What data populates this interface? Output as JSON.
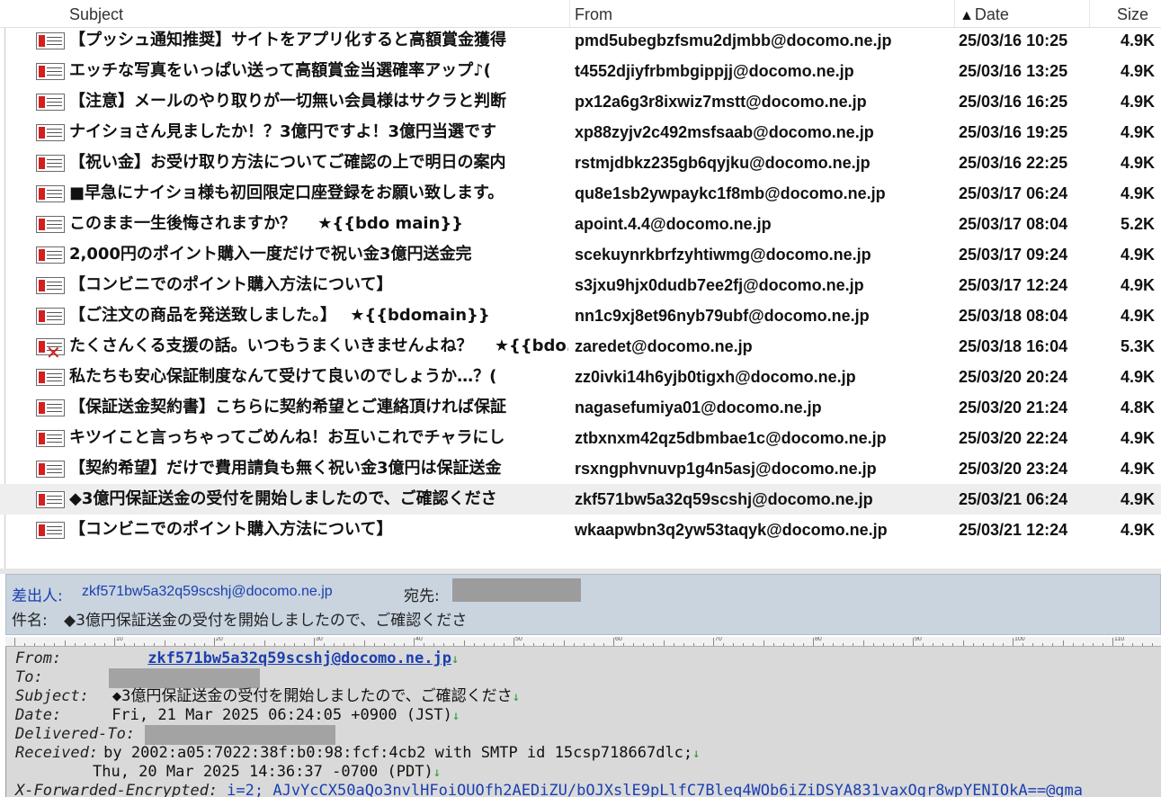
{
  "list": {
    "columns": {
      "subject": "Subject",
      "from": "From",
      "date": "Date",
      "size": "Size",
      "sort_arrow": "▲"
    },
    "rows": [
      {
        "subject": "【プッシュ通知推奨】サイトをアプリ化すると高額賞金獲得",
        "from": "pmd5ubegbzfsmu2djmbb@docomo.ne.jp",
        "date": "25/03/16 10:25",
        "size": "4.9K",
        "icon": "mail-icon"
      },
      {
        "subject": "エッチな写真をいっぱい送って高額賞金当選確率アップ♪(",
        "from": "t4552djiyfrbmbgippjj@docomo.ne.jp",
        "date": "25/03/16 13:25",
        "size": "4.9K",
        "icon": "mail-icon"
      },
      {
        "subject": "【注意】メールのやり取りが一切無い会員様はサクラと判断",
        "from": "px12a6g3r8ixwiz7mstt@docomo.ne.jp",
        "date": "25/03/16 16:25",
        "size": "4.9K",
        "icon": "mail-icon"
      },
      {
        "subject": "ナイショさん見ましたか！？3億円ですよ！3億円当選です",
        "from": "xp88zyjv2c492msfsaab@docomo.ne.jp",
        "date": "25/03/16 19:25",
        "size": "4.9K",
        "icon": "mail-icon"
      },
      {
        "subject": "【祝い金】お受け取り方法についてご確認の上で明日の案内",
        "from": "rstmjdbkz235gb6qyjku@docomo.ne.jp",
        "date": "25/03/16 22:25",
        "size": "4.9K",
        "icon": "mail-icon"
      },
      {
        "subject": "■早急にナイショ様も初回限定口座登録をお願い致します。",
        "from": "qu8e1sb2ywpaykc1f8mb@docomo.ne.jp",
        "date": "25/03/17 06:24",
        "size": "4.9K",
        "icon": "mail-icon"
      },
      {
        "subject": "このまま一生後悔されますか？　 ★{{bdo main}}",
        "from": "apoint.4.4@docomo.ne.jp",
        "date": "25/03/17 08:04",
        "size": "5.2K",
        "icon": "mail-icon"
      },
      {
        "subject": "2,000円のポイント購入一度だけで祝い金3億円送金完",
        "from": "scekuynrkbrfzyhtiwmg@docomo.ne.jp",
        "date": "25/03/17 09:24",
        "size": "4.9K",
        "icon": "mail-icon"
      },
      {
        "subject": "【コンビニでのポイント購入方法について】",
        "from": "s3jxu9hjx0dudb7ee2fj@docomo.ne.jp",
        "date": "25/03/17 12:24",
        "size": "4.9K",
        "icon": "mail-icon"
      },
      {
        "subject": "【ご注文の商品を発送致しました。】　 ★{{bdomain}}",
        "from": "nn1c9xj8et96nyb79ubf@docomo.ne.jp",
        "date": "25/03/18 08:04",
        "size": "4.9K",
        "icon": "mail-icon"
      },
      {
        "subject": "たくさんくる支援の話。いつもうまくいきませんよね？　 ★{{bdo...",
        "from": "zaredet@docomo.ne.jp",
        "date": "25/03/18 16:04",
        "size": "5.3K",
        "icon": "mail-error-icon"
      },
      {
        "subject": "私たちも安心保証制度なんて受けて良いのでしょうか…？(",
        "from": "zz0ivki14h6yjb0tigxh@docomo.ne.jp",
        "date": "25/03/20 20:24",
        "size": "4.9K",
        "icon": "mail-icon"
      },
      {
        "subject": "【保証送金契約書】こちらに契約希望とご連絡頂ければ保証",
        "from": "nagasefumiya01@docomo.ne.jp",
        "date": "25/03/20 21:24",
        "size": "4.8K",
        "icon": "mail-icon"
      },
      {
        "subject": "キツイこと言っちゃってごめんね！お互いこれでチャラにし",
        "from": "ztbxnxm42qz5dbmbae1c@docomo.ne.jp",
        "date": "25/03/20 22:24",
        "size": "4.9K",
        "icon": "mail-icon"
      },
      {
        "subject": "【契約希望】だけで費用請負も無く祝い金3億円は保証送金",
        "from": "rsxngphvnuvp1g4n5asj@docomo.ne.jp",
        "date": "25/03/20 23:24",
        "size": "4.9K",
        "icon": "mail-icon"
      },
      {
        "subject": "◆3億円保証送金の受付を開始しましたので、ご確認くださ",
        "from": "zkf571bw5a32q59scshj@docomo.ne.jp",
        "date": "25/03/21 06:24",
        "size": "4.9K",
        "icon": "mail-icon",
        "selected": true
      },
      {
        "subject": "【コンビニでのポイント購入方法について】",
        "from": "wkaapwbn3q2yw53taqyk@docomo.ne.jp",
        "date": "25/03/21 12:24",
        "size": "4.9K",
        "icon": "mail-icon"
      }
    ]
  },
  "summary": {
    "sender_label": "差出人:",
    "sender": "zkf571bw5a32q59scshj@docomo.ne.jp",
    "to_label": "宛先:",
    "subject_label": "件名:",
    "subject": "◆3億円保証送金の受付を開始しましたので、ご確認くださ"
  },
  "ruler": {
    "labels": [
      "10",
      "20",
      "30",
      "40",
      "50",
      "60",
      "70",
      "80",
      "90",
      "100",
      "110"
    ]
  },
  "raw": {
    "from_key": "From:",
    "from_val": "zkf571bw5a32q59scshj@docomo.ne.jp",
    "to_key": "To:",
    "subject_key": "Subject:",
    "subject_val": "◆3億円保証送金の受付を開始しましたので、ご確認くださ",
    "date_key": "Date:",
    "date_val": "Fri, 21 Mar 2025 06:24:05 +0900 (JST)",
    "delivered_key": "Delivered-To:",
    "received_key": "Received:",
    "received_val": "by 2002:a05:7022:38f:b0:98:fcf:4cb2 with SMTP id 15csp718667dlc;",
    "received_cont": "Thu, 20 Mar 2025 14:36:37 -0700 (PDT)",
    "xfwd_key": "X-Forwarded-Encrypted:",
    "xfwd_val": "i=2; AJvYcCX50aQo3nvlHFoiOUOfh2AEDiZU/bOJXslE9pLlfC7Bleq4WOb6iZiDSYA831vaxOgr8wpYENIOkA==@gma",
    "line_end": "↓"
  }
}
